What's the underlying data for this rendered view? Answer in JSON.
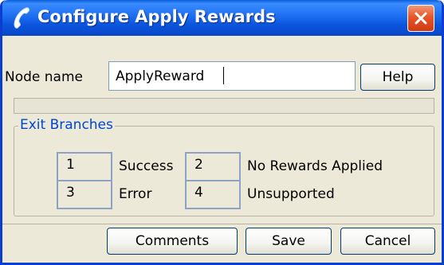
{
  "window": {
    "title": "Configure Apply Rewards"
  },
  "node": {
    "label": "Node name",
    "value": "ApplyReward"
  },
  "buttons": {
    "help": "Help",
    "comments": "Comments",
    "save": "Save",
    "cancel": "Cancel"
  },
  "exit_branches": {
    "title": "Exit Branches",
    "items": [
      {
        "id": "1",
        "label": "Success"
      },
      {
        "id": "2",
        "label": "No Rewards Applied"
      },
      {
        "id": "3",
        "label": "Error"
      },
      {
        "id": "4",
        "label": "Unsupported"
      }
    ]
  },
  "colors": {
    "titlebar": "#0b54dd",
    "close": "#e7552b",
    "group_title": "#0046d5"
  }
}
